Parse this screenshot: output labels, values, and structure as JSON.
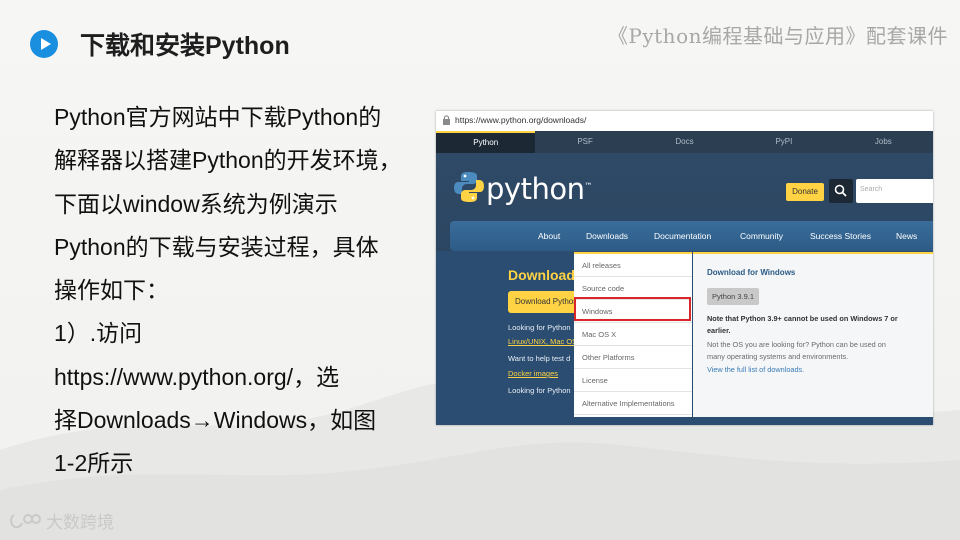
{
  "slide": {
    "title": "下载和安装Python",
    "series_title": "《Python编程基础与应用》配套课件",
    "body_lines": [
      "Python官方网站中下载Python的",
      "解释器以搭建Python的开发环境，",
      "下面以window系统为例演示",
      "Python的下载与安装过程，具体",
      "操作如下：",
      "1）.访问",
      "https://www.python.org/，选",
      "择Downloads→Windows，如图",
      "1-2所示"
    ],
    "logo_text": "大数跨境",
    "accent_color": "#1a8fe0"
  },
  "screenshot": {
    "address_url": "https://www.python.org/downloads/",
    "top_nav": [
      "Python",
      "PSF",
      "Docs",
      "PyPI",
      "Jobs"
    ],
    "top_nav_active": "Python",
    "brand_word": "python",
    "brand_mark": "™",
    "donate_label": "Donate",
    "search_placeholder": "Search",
    "main_nav": [
      "About",
      "Downloads",
      "Documentation",
      "Community",
      "Success Stories",
      "News"
    ],
    "download_heading": "Download",
    "download_button": "Download Python",
    "left_lines": [
      "Looking for Python",
      "Linux/UNIX, Mac OS",
      "Want to help test d",
      "Docker images",
      "Looking for Python"
    ],
    "dropdown_items": [
      "All releases",
      "Source code",
      "Windows",
      "Mac OS X",
      "Other Platforms",
      "License",
      "Alternative Implementations"
    ],
    "dropdown_highlight": "Windows",
    "flyout": {
      "heading": "Download for Windows",
      "button": "Python 3.9.1",
      "note_bold_1": "Note that Python 3.9+ cannot be used on Windows 7 or",
      "note_bold_2": "earlier.",
      "note_1": "Not the OS you are looking for? Python can be used on",
      "note_2": "many operating systems and environments.",
      "link": "View the full list of downloads."
    },
    "colors": {
      "nav_dark": "#2b3e52",
      "header_blue": "#2f4a66",
      "yellow": "#ffd343",
      "highlight_red": "#d9262b"
    }
  }
}
